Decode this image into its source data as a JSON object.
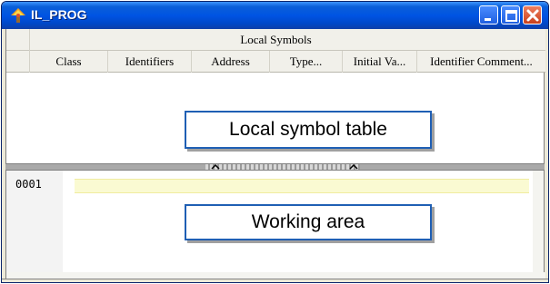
{
  "window": {
    "title": "IL_PROG"
  },
  "symbols": {
    "group_header": "Local Symbols",
    "columns": [
      "Class",
      "Identifiers",
      "Address",
      "Type...",
      "Initial Va...",
      "Identifier Comment..."
    ]
  },
  "callouts": {
    "symbol_table": "Local symbol table",
    "working_area": "Working area"
  },
  "editor": {
    "line_number": "0001"
  }
}
